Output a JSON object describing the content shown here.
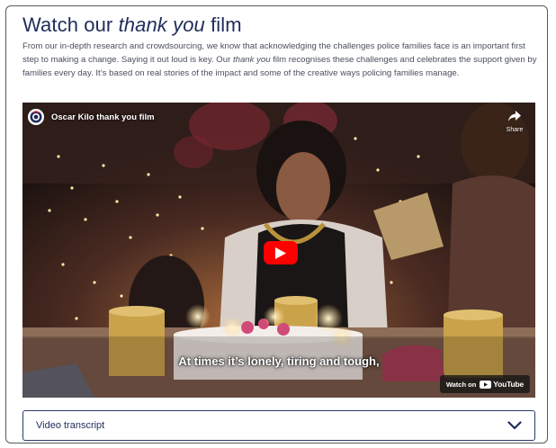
{
  "section": {
    "title_prefix": "Watch our ",
    "title_emphasis": "thank you",
    "title_suffix": " film",
    "intro": {
      "part1": "From our in-depth research and crowdsourcing, we know that acknowledging the challenges police families face is an important first step to making a change. Saying it out loud is key. Our ",
      "emphasis": "thank you",
      "part2": " film recognises these challenges and celebrates the support given by families every day. It’s based on real stories of the impact and some of the creative ways policing families manage."
    }
  },
  "video": {
    "title": "Oscar Kilo thank you film",
    "share_label": "Share",
    "caption": "At times it’s lonely, tiring and tough,",
    "watch_on_label": "Watch on",
    "youtube_label": "YouTube",
    "icons": {
      "channel": "channel-logo-icon",
      "share": "share-icon",
      "play": "play-icon",
      "youtube": "youtube-logo-icon"
    },
    "colors": {
      "play_button": "#ff0000"
    }
  },
  "transcript": {
    "label": "Video transcript",
    "icon": "chevron-down-icon"
  },
  "colors": {
    "heading": "#1f2d5a",
    "body_text": "#4a4f5c",
    "border": "#58595b"
  }
}
